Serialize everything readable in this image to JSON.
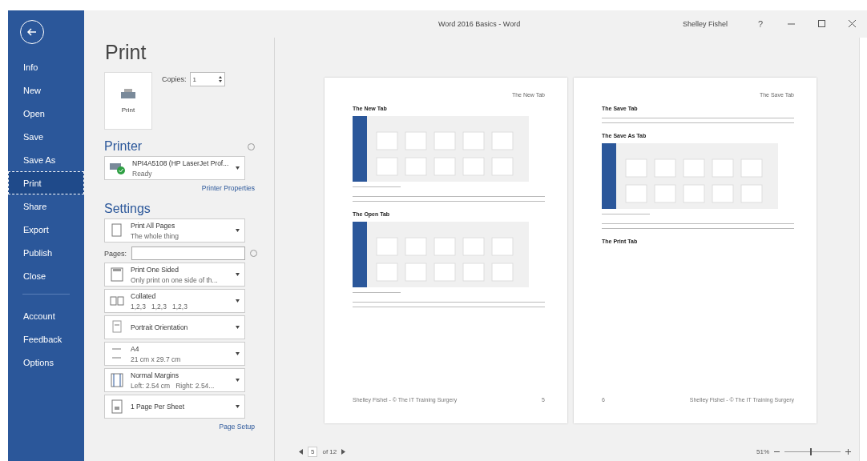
{
  "window": {
    "title": "Word 2016 Basics - Word",
    "user": "Shelley Fishel",
    "help": "?"
  },
  "sidebar": {
    "items": [
      {
        "label": "Info",
        "selected": false
      },
      {
        "label": "New",
        "selected": false
      },
      {
        "label": "Open",
        "selected": false
      },
      {
        "label": "Save",
        "selected": false
      },
      {
        "label": "Save As",
        "selected": false
      },
      {
        "label": "Print",
        "selected": true
      },
      {
        "label": "Share",
        "selected": false
      },
      {
        "label": "Export",
        "selected": false
      },
      {
        "label": "Publish",
        "selected": false
      },
      {
        "label": "Close",
        "selected": false
      }
    ],
    "bottom_items": [
      {
        "label": "Account",
        "selected": false
      },
      {
        "label": "Feedback",
        "selected": false
      },
      {
        "label": "Options",
        "selected": false
      }
    ]
  },
  "print": {
    "heading": "Print",
    "button": "Print",
    "copies_label": "Copies:",
    "copies_value": "1"
  },
  "printer": {
    "heading": "Printer",
    "name": "NPI4A5108 (HP LaserJet Prof...",
    "status": "Ready",
    "properties_link": "Printer Properties"
  },
  "settings": {
    "heading": "Settings",
    "pages_label": "Pages:",
    "page_setup_link": "Page Setup",
    "options": [
      {
        "kind": "pages",
        "title": "Print All Pages",
        "subtitle": "The whole thing"
      },
      {
        "kind": "sided",
        "title": "Print One Sided",
        "subtitle": "Only print on one side of th..."
      },
      {
        "kind": "collated",
        "title": "Collated",
        "subtitle": "1,2,3   1,2,3   1,2,3"
      },
      {
        "kind": "orientation",
        "title": "Portrait Orientation"
      },
      {
        "kind": "paper",
        "title": "A4",
        "subtitle": "21 cm x 29.7 cm"
      },
      {
        "kind": "margins",
        "title": "Normal Margins",
        "subtitle": "Left: 2.54 cm   Right: 2.54..."
      },
      {
        "kind": "sheet",
        "title": "1 Page Per Sheet"
      }
    ]
  },
  "preview": {
    "pages": [
      {
        "header": "The New Tab",
        "footer": "Shelley Fishel - © The IT Training Surgery",
        "page_number": "5",
        "blocks": [
          {
            "kind": "heading",
            "text": "The New Tab"
          },
          {
            "kind": "screenshot"
          },
          {
            "kind": "caption"
          },
          {
            "kind": "paragraph"
          },
          {
            "kind": "heading",
            "text": "The Open Tab"
          },
          {
            "kind": "screenshot"
          },
          {
            "kind": "caption"
          },
          {
            "kind": "paragraph"
          }
        ]
      },
      {
        "header": "The Save Tab",
        "footer": "Shelley Fishel - © The IT Training Surgery",
        "page_number": "6",
        "blocks": [
          {
            "kind": "heading",
            "text": "The Save Tab"
          },
          {
            "kind": "paragraph"
          },
          {
            "kind": "heading",
            "text": "The Save As Tab"
          },
          {
            "kind": "screenshot"
          },
          {
            "kind": "caption"
          },
          {
            "kind": "paragraph"
          },
          {
            "kind": "heading",
            "text": "The Print Tab"
          }
        ]
      }
    ],
    "nav": {
      "current": "5",
      "total": "of 12"
    },
    "zoom": {
      "reading": "51%",
      "level": 0.45
    }
  }
}
